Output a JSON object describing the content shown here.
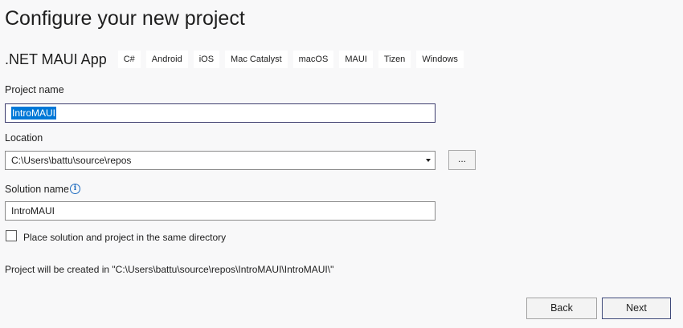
{
  "header": {
    "title": "Configure your new project"
  },
  "template": {
    "name": ".NET MAUI App",
    "tags": [
      "C#",
      "Android",
      "iOS",
      "Mac Catalyst",
      "macOS",
      "MAUI",
      "Tizen",
      "Windows"
    ]
  },
  "project_name": {
    "label": "Project name",
    "value": "IntroMAUI"
  },
  "location": {
    "label": "Location",
    "value": "C:\\Users\\battu\\source\\repos",
    "browse_label": "..."
  },
  "solution_name": {
    "label": "Solution name",
    "value": "IntroMAUI",
    "info_icon": "info-icon"
  },
  "same_directory": {
    "label": "Place solution and project in the same directory",
    "checked": false
  },
  "path_info": "Project will be created in \"C:\\Users\\battu\\source\\repos\\IntroMAUI\\IntroMAUI\\\"",
  "footer": {
    "back_label": "Back",
    "next_label": "Next"
  },
  "colors": {
    "background": "#f8f8f9",
    "selection": "#0078d7",
    "info_icon": "#1d6bbf"
  }
}
